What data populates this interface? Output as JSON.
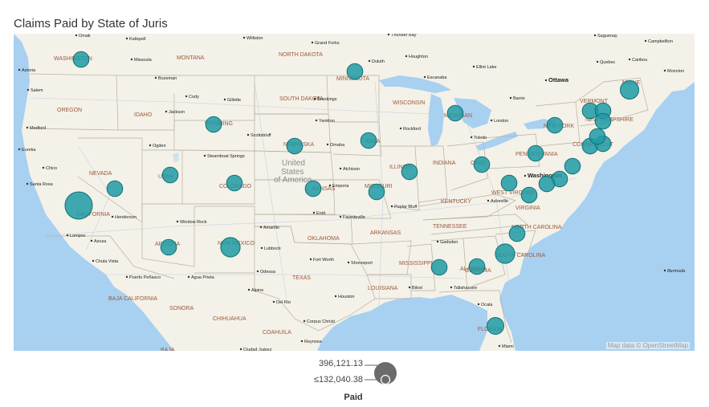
{
  "title": "Claims Paid by State of Juris",
  "attribution": "Map data © OpenStreetMap",
  "legend": {
    "title": "Paid",
    "max_label": "396,121.13",
    "min_label": "≤132,040.38"
  },
  "colors": {
    "water": "#a8d0f0",
    "land": "#f4f1e8",
    "bubble": "#1f9aa3",
    "bubble_stroke": "#0f6f76",
    "legend_bubble": "#666666"
  },
  "map_labels": {
    "regions": [
      "WASHINGTON",
      "MONTANA",
      "NORTH DAKOTA",
      "MINNESOTA",
      "OREGON",
      "IDAHO",
      "WYOMING",
      "SOUTH DAKOTA",
      "WISCONSIN",
      "MICHIGAN",
      "NEW YORK",
      "VERMONT",
      "MAINE",
      "NEW HAMPSHIRE",
      "NEVADA",
      "UTAH",
      "COLORADO",
      "NEBRASKA",
      "IOWA",
      "ILLINOIS",
      "INDIANA",
      "OHIO",
      "PENNSYLVANIA",
      "CONNECTICUT",
      "CALIFORNIA",
      "ARIZONA",
      "NEW MEXICO",
      "OKLAHOMA",
      "KANSAS",
      "MISSOURI",
      "KENTUCKY",
      "WEST VIRGINIA",
      "VIRGINIA",
      "TENNESSEE",
      "NORTH CAROLINA",
      "SOUTH CAROLINA",
      "ARKANSAS",
      "MISSISSIPPI",
      "ALABAMA",
      "GEORGIA",
      "LOUISIANA",
      "TEXAS",
      "FLORIDA",
      "BAJA CALIFORNIA",
      "SONORA",
      "CHIHUAHUA",
      "COAHUILA",
      "BAJA"
    ],
    "country": [
      "United",
      "States",
      "of America"
    ],
    "cities": [
      "Omak",
      "Kalispell",
      "Williston",
      "Grand Forks",
      "Thunder Bay",
      "Saguenay",
      "Campbellton",
      "Astoria",
      "Missoula",
      "Duluth",
      "Houghton",
      "Elliot Lake",
      "Quebec",
      "Caribou",
      "Moncton",
      "Salem",
      "Bozeman",
      "Escanaba",
      "Ottawa",
      "Cody",
      "Gillette",
      "Brookings",
      "Barrie",
      "Medford",
      "Jackson",
      "Yankton",
      "Rockford",
      "London",
      "Eureka",
      "Ogden",
      "Scottsbluff",
      "Omaha",
      "Toledo",
      "Chico",
      "Steamboat Springs",
      "Atchison",
      "Washington",
      "Santa Rosa",
      "Emporia",
      "Henderson",
      "Enid",
      "Fayetteville",
      "Poplar Bluff",
      "Asheville",
      "Window Rock",
      "Amarillo",
      "Gadsden",
      "Lompoc",
      "Azusa",
      "Lubbock",
      "Fort Worth",
      "Shreveport",
      "Chula Vista",
      "Puerto Peñasco",
      "Agua Prieta",
      "Odessa",
      "Tallahassee",
      "Alpine",
      "Del Rio",
      "Houston",
      "Biloxi",
      "Ocala",
      "Corpus Christi",
      "Reynosa",
      "Ciudad Juárez",
      "Miami",
      "Bermuda"
    ]
  },
  "bubbles": [
    {
      "state": "Washington",
      "paid": 132040
    },
    {
      "state": "California",
      "paid": 396121
    },
    {
      "state": "Nevada",
      "paid": 132040
    },
    {
      "state": "Utah",
      "paid": 132040
    },
    {
      "state": "Arizona",
      "paid": 132040
    },
    {
      "state": "Colorado",
      "paid": 132040
    },
    {
      "state": "Wyoming",
      "paid": 132040
    },
    {
      "state": "New Mexico",
      "paid": 200000
    },
    {
      "state": "Nebraska",
      "paid": 132040
    },
    {
      "state": "Kansas",
      "paid": 132040
    },
    {
      "state": "Minnesota",
      "paid": 132040
    },
    {
      "state": "Iowa",
      "paid": 132040
    },
    {
      "state": "Missouri",
      "paid": 132040
    },
    {
      "state": "Illinois",
      "paid": 132040
    },
    {
      "state": "Michigan",
      "paid": 132040
    },
    {
      "state": "Ohio",
      "paid": 132040
    },
    {
      "state": "Pennsylvania",
      "paid": 132040
    },
    {
      "state": "New York",
      "paid": 132040
    },
    {
      "state": "Maine",
      "paid": 180000
    },
    {
      "state": "Vermont",
      "paid": 132040
    },
    {
      "state": "New Hampshire",
      "paid": 132040
    },
    {
      "state": "Massachusetts",
      "paid": 132040
    },
    {
      "state": "Connecticut",
      "paid": 132040
    },
    {
      "state": "Rhode Island",
      "paid": 132040
    },
    {
      "state": "New Jersey",
      "paid": 132040
    },
    {
      "state": "Delaware",
      "paid": 132040
    },
    {
      "state": "Maryland",
      "paid": 132040
    },
    {
      "state": "Virginia",
      "paid": 132040
    },
    {
      "state": "West Virginia",
      "paid": 132040
    },
    {
      "state": "Kentucky",
      "paid": 132040
    },
    {
      "state": "North Carolina",
      "paid": 132040
    },
    {
      "state": "South Carolina",
      "paid": 200000
    },
    {
      "state": "Georgia",
      "paid": 132040
    },
    {
      "state": "Alabama",
      "paid": 132040
    },
    {
      "state": "Florida",
      "paid": 150000
    }
  ]
}
